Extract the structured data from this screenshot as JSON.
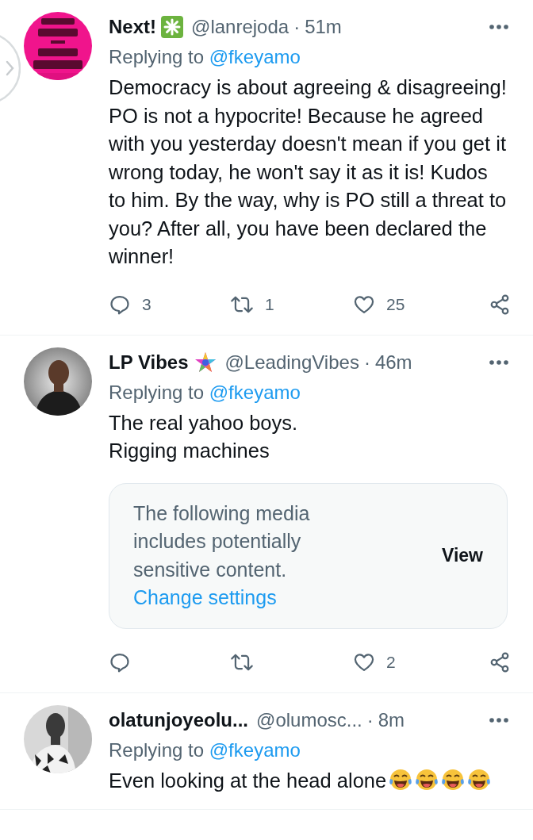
{
  "tweets": [
    {
      "name": "Next!",
      "badge": {
        "kind": "sparkle"
      },
      "handle": "@lanrejoda",
      "separator": "·",
      "time": "51m",
      "replying_label": "Replying to",
      "replying_to": "@fkeyamo",
      "text": "Democracy is about agreeing & disagreeing! PO is not a hypocrite! Because he agreed with you yesterday doesn't mean if you get it wrong today, he won't say it as it is! Kudos to him. By the way, why is PO still a threat to you? After all, you have been declared the winner!",
      "actions": {
        "replies": "3",
        "reposts": "1",
        "likes": "25"
      }
    },
    {
      "name": "LP Vibes",
      "badge": {
        "kind": "star"
      },
      "handle": "@LeadingVibes",
      "separator": "·",
      "time": "46m",
      "replying_label": "Replying to",
      "replying_to": "@fkeyamo",
      "text": "The real yahoo boys.\nRigging machines",
      "media_warning": {
        "text": "The following media includes potentially sensitive content.",
        "link": "Change settings",
        "button": "View"
      },
      "actions": {
        "likes": "2"
      }
    },
    {
      "name": "olatunjoyeolu...",
      "handle": "@olumosc...",
      "separator": "·",
      "time": "8m",
      "replying_label": "Replying to",
      "replying_to": "@fkeyamo",
      "text": "Even looking at the head alone",
      "emojis": [
        {
          "kind": "tears-of-joy"
        },
        {
          "kind": "tears-of-joy"
        },
        {
          "kind": "tears-of-joy"
        },
        {
          "kind": "tears-of-joy"
        }
      ]
    }
  ]
}
